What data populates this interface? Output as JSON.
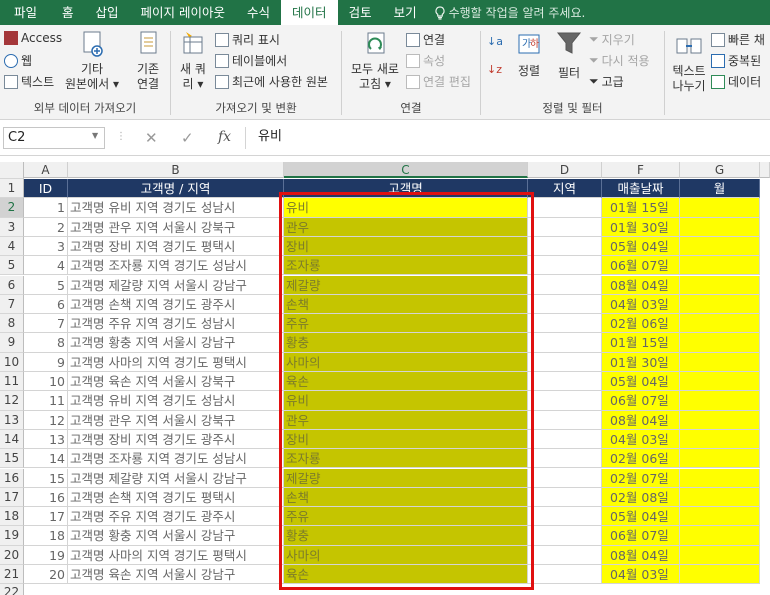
{
  "menu": {
    "tabs": [
      "파일",
      "홈",
      "삽입",
      "페이지 레이아웃",
      "수식",
      "데이터",
      "검토",
      "보기"
    ],
    "active": "데이터",
    "tell_me": "수행할 작업을 알려 주세요."
  },
  "ribbon": {
    "external": {
      "access": "Access",
      "web": "웹",
      "text": "텍스트",
      "other_l1": "기타",
      "other_l2": "원본에서 ▾",
      "existing_l1": "기존",
      "existing_l2": "연결",
      "label": "외부 데이터 가져오기"
    },
    "transform": {
      "new_query_l1": "새 쿼",
      "new_query_l2": "리 ▾",
      "show_query": "쿼리 표시",
      "from_table": "테이블에서",
      "recent": "최근에 사용한 원본",
      "label": "가져오기 및 변환"
    },
    "connections": {
      "refresh_l1": "모두 새로",
      "refresh_l2": "고침 ▾",
      "conn": "연결",
      "props": "속성",
      "edit_links": "연결 편집",
      "label": "연결"
    },
    "sort": {
      "az": "정렬",
      "filter": "필터",
      "clear": "지우기",
      "reapply": "다시 적용",
      "advanced": "고급",
      "label": "정렬 및 필터"
    },
    "tools": {
      "text_to_cols_l1": "텍스트",
      "text_to_cols_l2": "나누기",
      "flash": "빠른 채",
      "dup": "중복된",
      "validate": "데이터"
    }
  },
  "formula_bar": {
    "name_box": "C2",
    "cancel": "✕",
    "enter": "✓",
    "fx": "fx",
    "value": "유비"
  },
  "sheet": {
    "col_letters": [
      "A",
      "B",
      "C",
      "D",
      "F",
      "G"
    ],
    "headers": [
      "ID",
      "고객명 / 지역",
      "고객명",
      "지역",
      "매출날짜",
      "월"
    ],
    "rows": [
      {
        "id": "1",
        "name_region": "고객명 유비 지역 경기도 성남시",
        "name": "유비",
        "date": "01월 15일"
      },
      {
        "id": "2",
        "name_region": "고객명 관우 지역 서울시 강북구",
        "name": "관우",
        "date": "01월 30일"
      },
      {
        "id": "3",
        "name_region": "고객명 장비 지역 경기도 평택시",
        "name": "장비",
        "date": "05월 04일"
      },
      {
        "id": "4",
        "name_region": "고객명 조자룡 지역 경기도 성남시",
        "name": "조자룡",
        "date": "06월 07일"
      },
      {
        "id": "5",
        "name_region": "고객명 제갈량 지역 서울시 강남구",
        "name": "제갈량",
        "date": "08월 04일"
      },
      {
        "id": "6",
        "name_region": "고객명 손책 지역 경기도 광주시",
        "name": "손책",
        "date": "04월 03일"
      },
      {
        "id": "7",
        "name_region": "고객명 주유 지역 경기도 성남시",
        "name": "주유",
        "date": "02월 06일"
      },
      {
        "id": "8",
        "name_region": "고객명 황충 지역 서울시 강남구",
        "name": "황충",
        "date": "01월 15일"
      },
      {
        "id": "9",
        "name_region": "고객명 사마의 지역 경기도 평택시",
        "name": "사마의",
        "date": "01월 30일"
      },
      {
        "id": "10",
        "name_region": "고객명 육손 지역 서울시 강북구",
        "name": "육손",
        "date": "05월 04일"
      },
      {
        "id": "11",
        "name_region": "고객명 유비 지역 경기도 성남시",
        "name": "유비",
        "date": "06월 07일"
      },
      {
        "id": "12",
        "name_region": "고객명 관우 지역 서울시 강북구",
        "name": "관우",
        "date": "08월 04일"
      },
      {
        "id": "13",
        "name_region": "고객명 장비 지역 경기도 광주시",
        "name": "장비",
        "date": "04월 03일"
      },
      {
        "id": "14",
        "name_region": "고객명 조자룡 지역 경기도 성남시",
        "name": "조자룡",
        "date": "02월 06일"
      },
      {
        "id": "15",
        "name_region": "고객명 제갈량 지역 서울시 강남구",
        "name": "제갈량",
        "date": "02월 07일"
      },
      {
        "id": "16",
        "name_region": "고객명 손책 지역 경기도 평택시",
        "name": "손책",
        "date": "02월 08일"
      },
      {
        "id": "17",
        "name_region": "고객명 주유 지역 경기도 광주시",
        "name": "주유",
        "date": "05월 04일"
      },
      {
        "id": "18",
        "name_region": "고객명 황충 지역 서울시 강남구",
        "name": "황충",
        "date": "06월 07일"
      },
      {
        "id": "19",
        "name_region": "고객명 사마의 지역 경기도 평택시",
        "name": "사마의",
        "date": "08월 04일"
      },
      {
        "id": "20",
        "name_region": "고객명 육손 지역 서울시 강남구",
        "name": "육손",
        "date": "04월 03일"
      }
    ],
    "last_row_number": "22"
  },
  "colors": {
    "ribbon_green": "#217346",
    "header_navy": "#1f3864",
    "highlight_yellow": "#ffff00",
    "selection_olive": "#c5c500",
    "annotation_red": "#e01010"
  }
}
